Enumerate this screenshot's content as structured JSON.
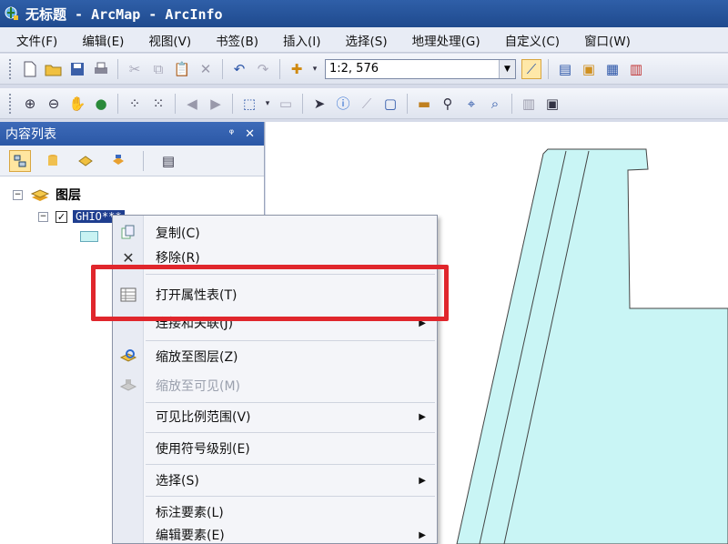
{
  "window": {
    "title": "无标题 - ArcMap - ArcInfo",
    "title_color": "#1f4a8e"
  },
  "menubar": {
    "items": [
      "文件(F)",
      "编辑(E)",
      "视图(V)",
      "书签(B)",
      "插入(I)",
      "选择(S)",
      "地理处理(G)",
      "自定义(C)",
      "窗口(W)"
    ]
  },
  "toolbar": {
    "scale_value": "1:2, 576"
  },
  "toc": {
    "title": "内容列表",
    "pin_label": "ᵠ",
    "close_label": "✕",
    "root_layer": "图层",
    "layer_name": "GHIO***"
  },
  "context_menu": {
    "items": [
      {
        "label": "复制(C)",
        "icon": "copy-icon"
      },
      {
        "label": "移除(R)",
        "icon": "remove-icon"
      },
      {
        "label": "打开属性表(T)",
        "icon": "table-icon"
      },
      {
        "label": "连接和关联(J)",
        "icon": "none",
        "submenu": true
      },
      {
        "label": "缩放至图层(Z)",
        "icon": "zoom-layer-icon"
      },
      {
        "label": "缩放至可见(M)",
        "icon": "zoom-visible-icon",
        "disabled": true
      },
      {
        "label": "可见比例范围(V)",
        "icon": "none",
        "submenu": true
      },
      {
        "label": "使用符号级别(E)",
        "icon": "none"
      },
      {
        "label": "选择(S)",
        "icon": "none",
        "submenu": true
      },
      {
        "label": "标注要素(L)",
        "icon": "none"
      },
      {
        "label": "编辑要素(E)",
        "icon": "none",
        "submenu": true
      }
    ],
    "highlight_color": "#e0262c"
  },
  "map": {
    "feature_fill": "#c9f5f5",
    "feature_stroke": "#444444"
  }
}
